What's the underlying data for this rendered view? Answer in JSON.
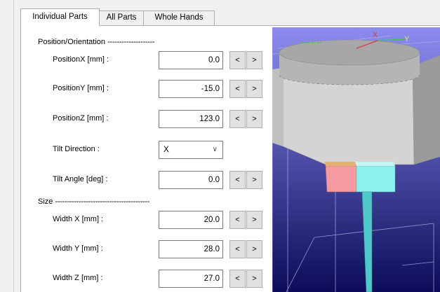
{
  "tabs": [
    {
      "label": "Individual Parts",
      "active": true
    },
    {
      "label": "All Parts",
      "active": false
    },
    {
      "label": "Whole Hands",
      "active": false
    }
  ],
  "sections": {
    "position": {
      "title": "Position/Orientation",
      "dashes": "--------------------"
    },
    "size": {
      "title": "Size",
      "dashes": "----------------------------------------"
    }
  },
  "fields": {
    "position_x": {
      "label": "PositionX [mm] :",
      "value": "0.0"
    },
    "position_y": {
      "label": "PositionY [mm] :",
      "value": "-15.0"
    },
    "position_z": {
      "label": "PositionZ [mm] :",
      "value": "123.0"
    },
    "tilt_direction": {
      "label": "Tilt Direction :",
      "value": "X"
    },
    "tilt_angle": {
      "label": "Tilt Angle [deg] :",
      "value": "0.0"
    },
    "width_x": {
      "label": "Width X [mm] :",
      "value": "20.0"
    },
    "width_y": {
      "label": "Width Y [mm] :",
      "value": "28.0"
    },
    "width_z": {
      "label": "Width Z [mm] :",
      "value": "27.0"
    }
  },
  "stepper": {
    "decrement": "<",
    "increment": ">"
  },
  "select_chevron": "∨",
  "viewport": {
    "axis_x_label": "X",
    "axis_y_label": "Y",
    "colors": {
      "background_top": "#8d8df0",
      "background_bottom": "#0c0c5a",
      "box": "#d8d8d8",
      "pink_part": "#f49aa0",
      "cyan_part": "#8ff0f0",
      "rod": "#4ec8c8",
      "axis_x": "#e03a3a",
      "axis_y": "#3ec83e"
    }
  }
}
